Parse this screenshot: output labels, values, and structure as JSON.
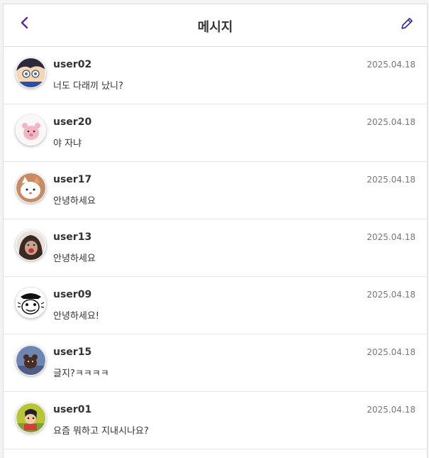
{
  "header": {
    "title": "메시지",
    "back_icon": "chevron-left-icon",
    "edit_icon": "pencil-icon",
    "accent": "#5b2a9e"
  },
  "messages": [
    {
      "user": "user02",
      "text": "너도 다래끼 났니?",
      "date": "2025.04.18"
    },
    {
      "user": "user20",
      "text": "야 자냐",
      "date": "2025.04.18"
    },
    {
      "user": "user17",
      "text": "안녕하세요",
      "date": "2025.04.18"
    },
    {
      "user": "user13",
      "text": "안녕하세요",
      "date": "2025.04.18"
    },
    {
      "user": "user09",
      "text": "안녕하세요!",
      "date": "2025.04.18"
    },
    {
      "user": "user15",
      "text": "글지?ㅋㅋㅋㅋ",
      "date": "2025.04.18"
    },
    {
      "user": "user01",
      "text": "요즘 뭐하고 지내시나요?",
      "date": "2025.04.18"
    }
  ]
}
